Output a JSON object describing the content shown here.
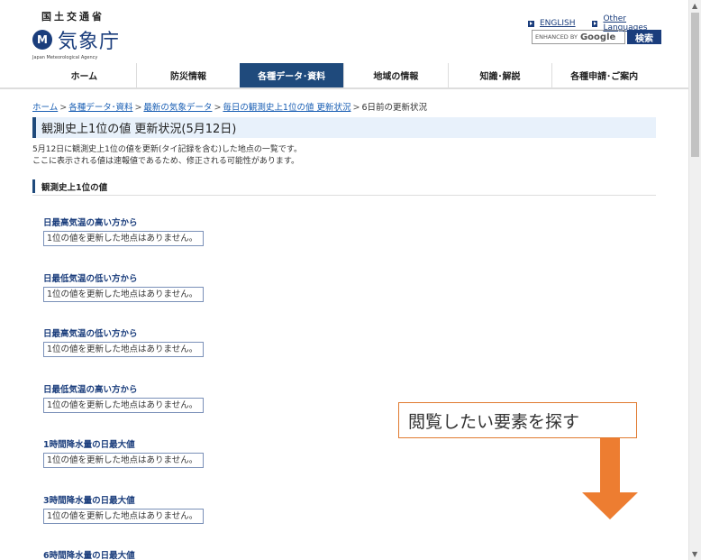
{
  "header": {
    "ministry": "国土交通省",
    "logo_mark": "M",
    "agency_name": "気象庁",
    "agency_en": "Japan Meteorological Agency",
    "lang_links": [
      "ENGLISH",
      "Other Languages"
    ],
    "search": {
      "prefix": "ENHANCED BY",
      "brand": "Google",
      "button": "検索"
    }
  },
  "nav": {
    "items": [
      "ホーム",
      "防災情報",
      "各種データ･資料",
      "地域の情報",
      "知識･解説",
      "各種申請･ご案内"
    ],
    "active_index": 2
  },
  "breadcrumb": {
    "links": [
      "ホーム",
      "各種データ･資料",
      "最新の気象データ",
      "毎日の観測史上1位の値 更新状況"
    ],
    "separator": ">",
    "current": "6日前の更新状況"
  },
  "page": {
    "title": "観測史上1位の値 更新状況(5月12日)",
    "intro_line1": "5月12日に観測史上1位の値を更新(タイ記録を含む)した地点の一覧です。",
    "intro_line2": "ここに表示される値は速報値であるため、修正される可能性があります。",
    "section_title": "観測史上1位の値",
    "blocks": [
      {
        "title": "日最高気温の高い方から",
        "message": "1位の値を更新した地点はありません。"
      },
      {
        "title": "日最低気温の低い方から",
        "message": "1位の値を更新した地点はありません。"
      },
      {
        "title": "日最高気温の低い方から",
        "message": "1位の値を更新した地点はありません。"
      },
      {
        "title": "日最低気温の高い方から",
        "message": "1位の値を更新した地点はありません。"
      },
      {
        "title": "1時間降水量の日最大値",
        "message": "1位の値を更新した地点はありません。"
      },
      {
        "title": "3時間降水量の日最大値",
        "message": "1位の値を更新した地点はありません。"
      },
      {
        "title": "6時間降水量の日最大値",
        "message": ""
      }
    ]
  },
  "overlay": {
    "callout_text": "閲覧したい要素を探す",
    "accent_color": "#ED7D31"
  },
  "colors": {
    "brand": "#1F4A7C",
    "link": "#1A5FB4",
    "title_bg": "#E8F1FB"
  },
  "scrollbar": {
    "up": "▲",
    "down": "▼"
  }
}
